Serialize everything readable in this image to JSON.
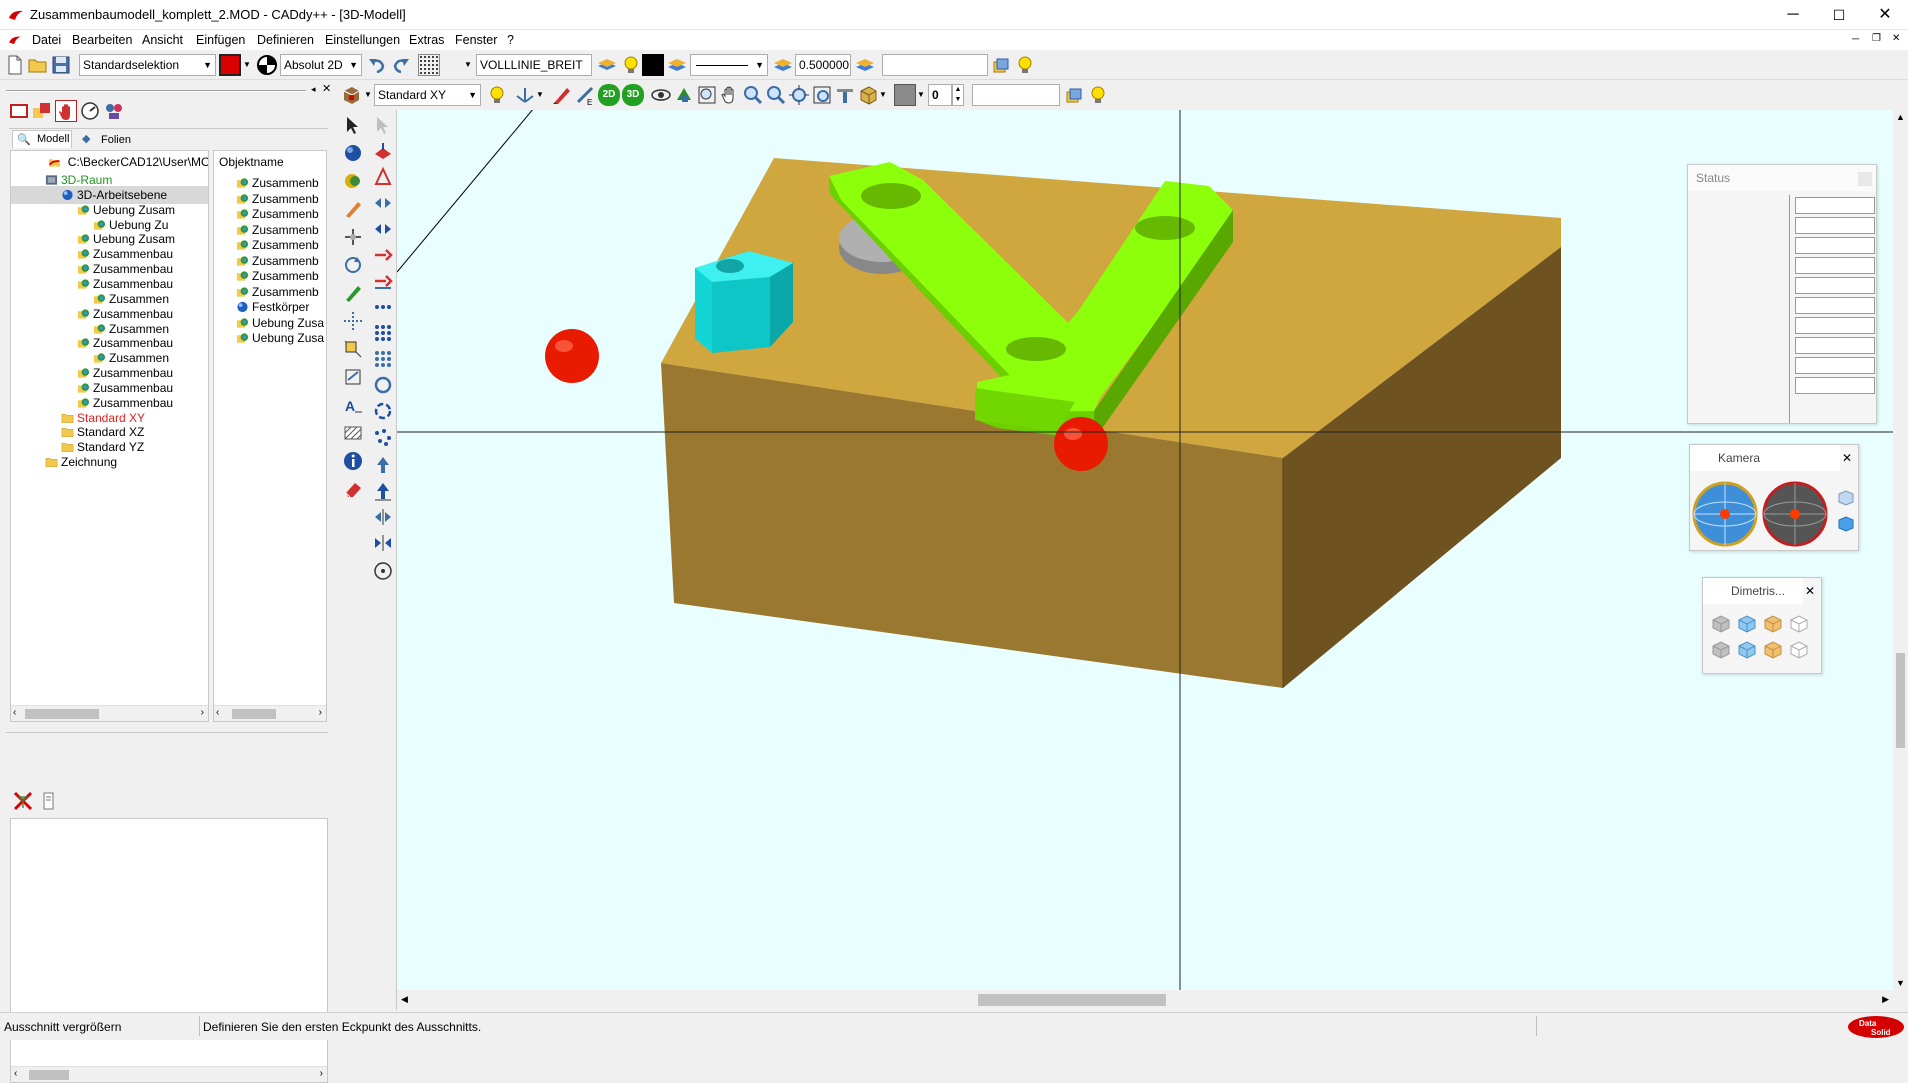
{
  "titlebar": {
    "title": "Zusammenbaumodell_komplett_2.MOD  -  CADdy++ - [3D-Modell]",
    "minimize": "─",
    "maximize": "☐",
    "close": "✕"
  },
  "menu": {
    "items": [
      "Datei",
      "Bearbeiten",
      "Ansicht",
      "Einfügen",
      "Definieren",
      "Einstellungen",
      "Extras",
      "Fenster",
      "?"
    ]
  },
  "toolbar1": {
    "selection_mode": "Standardselektion",
    "coord_mode": "Absolut 2D",
    "linetype": "VOLLLINIE_BREIT",
    "line_width": "0.500000"
  },
  "toolbar2": {
    "view": "Standard XY",
    "btn_2d": "2D",
    "btn_3d": "3D",
    "layer_value": "0"
  },
  "leftpanel": {
    "tabs": [
      "Modell",
      "Folien"
    ],
    "path": "C:\\BeckerCAD12\\User\\MO",
    "tree": [
      {
        "label": "3D-Raum",
        "indent": 1,
        "color": "#1a9a1a",
        "icon": "cube"
      },
      {
        "label": "3D-Arbeitsebene",
        "indent": 2,
        "color": "#000",
        "icon": "sphere",
        "selected": true
      },
      {
        "label": "Uebung Zusam",
        "indent": 3,
        "color": "#000",
        "icon": "part"
      },
      {
        "label": "Uebung Zu",
        "indent": 4,
        "color": "#000",
        "icon": "part"
      },
      {
        "label": "Uebung Zusam",
        "indent": 3,
        "color": "#000",
        "icon": "part"
      },
      {
        "label": "Zusammenbau",
        "indent": 3,
        "color": "#000",
        "icon": "part"
      },
      {
        "label": "Zusammenbau",
        "indent": 3,
        "color": "#000",
        "icon": "part"
      },
      {
        "label": "Zusammenbau",
        "indent": 3,
        "color": "#000",
        "icon": "part"
      },
      {
        "label": "Zusammen",
        "indent": 4,
        "color": "#000",
        "icon": "part"
      },
      {
        "label": "Zusammenbau",
        "indent": 3,
        "color": "#000",
        "icon": "part"
      },
      {
        "label": "Zusammen",
        "indent": 4,
        "color": "#000",
        "icon": "part"
      },
      {
        "label": "Zusammenbau",
        "indent": 3,
        "color": "#000",
        "icon": "part"
      },
      {
        "label": "Zusammen",
        "indent": 4,
        "color": "#000",
        "icon": "part"
      },
      {
        "label": "Zusammenbau",
        "indent": 3,
        "color": "#000",
        "icon": "part"
      },
      {
        "label": "Zusammenbau",
        "indent": 3,
        "color": "#000",
        "icon": "part"
      },
      {
        "label": "Zusammenbau",
        "indent": 3,
        "color": "#000",
        "icon": "part"
      },
      {
        "label": "Standard XY",
        "indent": 2,
        "color": "#e02020",
        "icon": "folder"
      },
      {
        "label": "Standard XZ",
        "indent": 2,
        "color": "#000",
        "icon": "folder"
      },
      {
        "label": "Standard YZ",
        "indent": 2,
        "color": "#000",
        "icon": "folder"
      },
      {
        "label": "Zeichnung",
        "indent": 1,
        "color": "#000",
        "icon": "folder"
      }
    ],
    "object_header": "Objektname",
    "objects": [
      {
        "label": "Zusammenb",
        "icon": "part"
      },
      {
        "label": "Zusammenb",
        "icon": "part"
      },
      {
        "label": "Zusammenb",
        "icon": "part"
      },
      {
        "label": "Zusammenb",
        "icon": "part"
      },
      {
        "label": "Zusammenb",
        "icon": "part"
      },
      {
        "label": "Zusammenb",
        "icon": "part"
      },
      {
        "label": "Zusammenb",
        "icon": "part"
      },
      {
        "label": "Zusammenb",
        "icon": "part"
      },
      {
        "label": "Festkörper",
        "icon": "sphere"
      },
      {
        "label": "Uebung Zusa",
        "icon": "part"
      },
      {
        "label": "Uebung Zusa",
        "icon": "part"
      }
    ]
  },
  "panels": {
    "status_title": "Status",
    "kamera_title": "Kamera",
    "dimetric_title": "Dimetris..."
  },
  "statusbar": {
    "left": "Ausschnitt vergrößern",
    "message": "Definieren Sie den ersten Eckpunkt des Ausschnitts."
  },
  "colors": {
    "viewport_bg": "#e8feff",
    "block_top": "#d0a63e",
    "plate_green": "#8cff0a",
    "hex_nut": "#16dede",
    "marker_red": "#e81b00"
  }
}
